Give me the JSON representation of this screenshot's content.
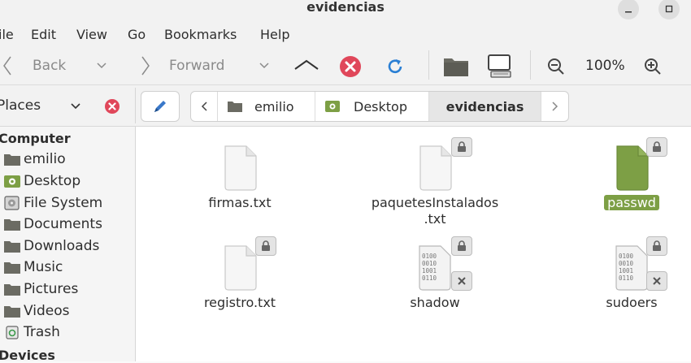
{
  "window": {
    "title": "evidencias"
  },
  "menu": [
    "ile",
    "Edit",
    "View",
    "Go",
    "Bookmarks",
    "Help"
  ],
  "toolbar": {
    "back_label": "Back",
    "forward_label": "Forward",
    "zoom_level": "100%"
  },
  "places": {
    "label": "Places"
  },
  "breadcrumb": [
    "emilio",
    "Desktop",
    "evidencias"
  ],
  "sidebar": {
    "computer_heading": "Computer",
    "items": [
      "emilio",
      "Desktop",
      "File System",
      "Documents",
      "Downloads",
      "Music",
      "Pictures",
      "Videos",
      "Trash"
    ],
    "devices_heading": "Devices"
  },
  "files": [
    {
      "name": "firmas.txt",
      "kind": "text",
      "locked": false
    },
    {
      "name": "paquetesInstalados",
      "name2": ".txt",
      "kind": "text",
      "locked": true
    },
    {
      "name": "passwd",
      "kind": "text",
      "locked": true,
      "selected": true
    },
    {
      "name": "registro.txt",
      "kind": "text",
      "locked": true
    },
    {
      "name": "shadow",
      "kind": "binary",
      "locked": true,
      "unreadable": true
    },
    {
      "name": "sudoers",
      "kind": "binary",
      "locked": true,
      "unreadable": true
    }
  ],
  "colors": {
    "accent": "#7d9f45",
    "stop": "#e0475a",
    "reload": "#2a7fd4",
    "folder": "#6b6b63"
  }
}
